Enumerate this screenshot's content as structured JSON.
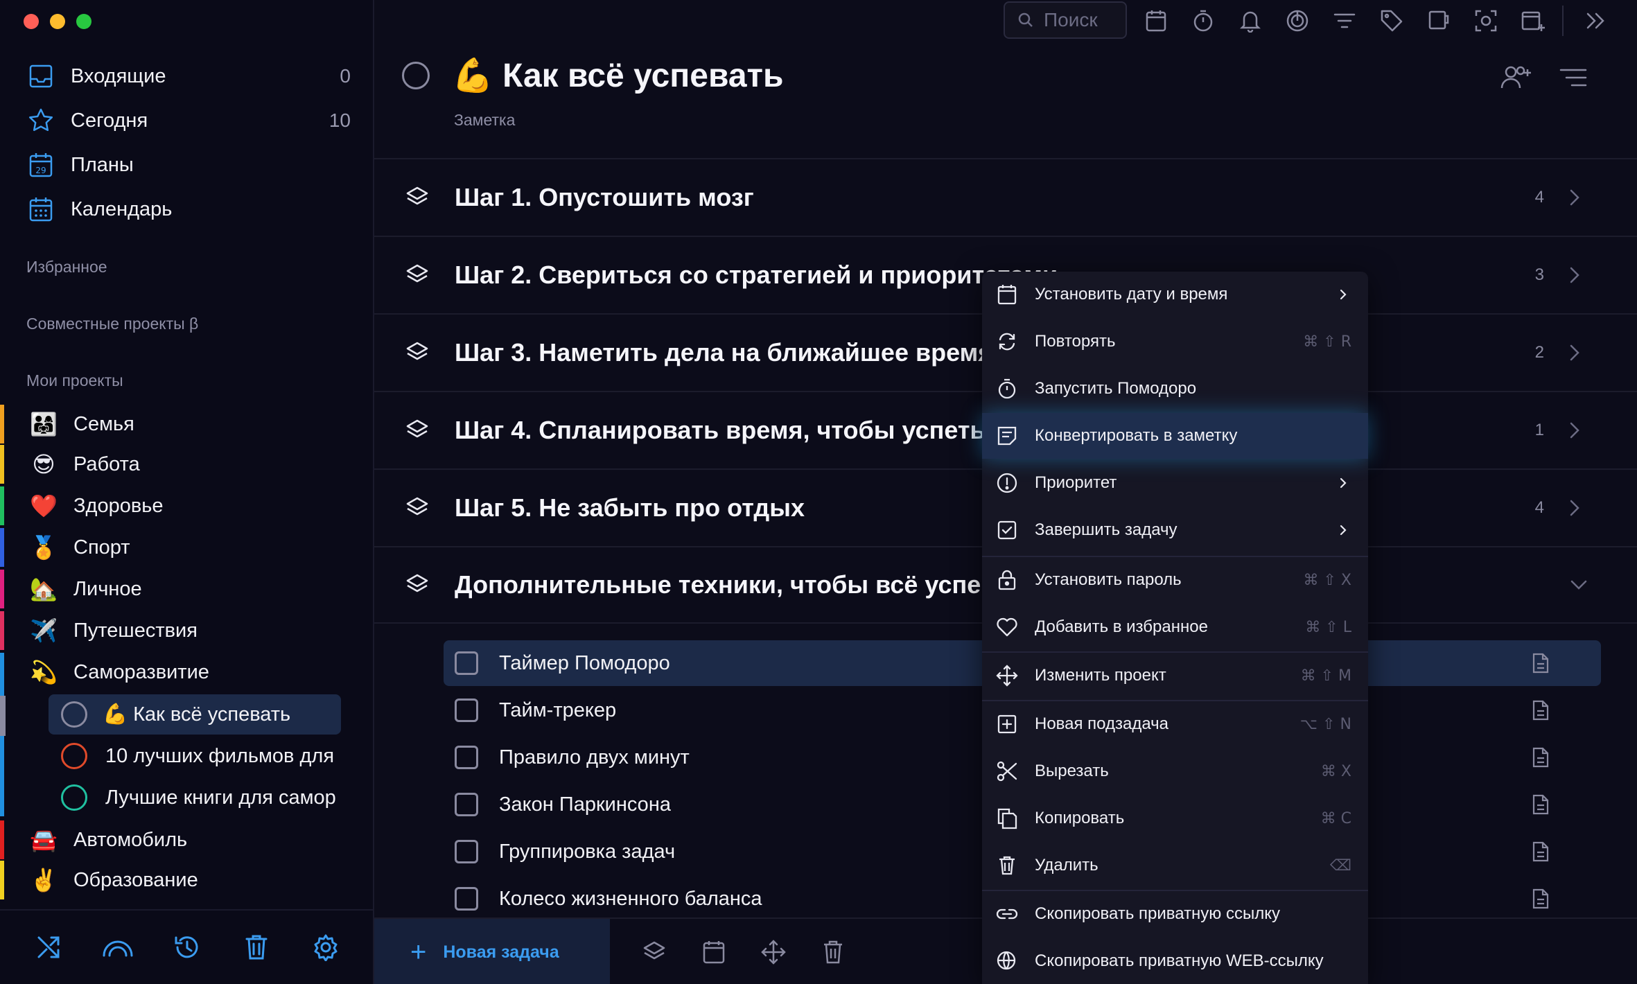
{
  "sidebar": {
    "nav": [
      {
        "label": "Входящие",
        "count": "0",
        "icon": "inbox-icon"
      },
      {
        "label": "Сегодня",
        "count": "10",
        "icon": "star-icon"
      },
      {
        "label": "Планы",
        "count": "",
        "icon": "calendar-29-icon"
      },
      {
        "label": "Календарь",
        "count": "",
        "icon": "calendar-grid-icon"
      }
    ],
    "favorites_title": "Избранное",
    "shared_title": "Совместные проекты β",
    "my_projects_title": "Мои проекты",
    "projects": [
      {
        "label": "Семья",
        "emoji": "👨‍👩‍👧",
        "color": "#f0a020"
      },
      {
        "label": "Работа",
        "emoji": "😎",
        "color": "#f0c020"
      },
      {
        "label": "Здоровье",
        "emoji": "❤️",
        "color": "#20c060"
      },
      {
        "label": "Спорт",
        "emoji": "🏅",
        "color": "#3060e0"
      },
      {
        "label": "Личное",
        "emoji": "🏡",
        "color": "#e02080"
      },
      {
        "label": "Путешествия",
        "emoji": "✈️",
        "color": "#e03060"
      },
      {
        "label": "Саморазвитие",
        "emoji": "💫",
        "color": "#2090e0"
      },
      {
        "label": "Автомобиль",
        "emoji": "🚘",
        "color": "#e02020"
      },
      {
        "label": "Образование",
        "emoji": "✌️",
        "color": "#f0d020"
      }
    ],
    "sub_items": [
      {
        "label": "💪 Как всё успевать",
        "circle": "#8a8aa0"
      },
      {
        "label": "10 лучших фильмов для",
        "circle": "#e04a2a"
      },
      {
        "label": "Лучшие книги для самор",
        "circle": "#20c0a0"
      }
    ]
  },
  "topbar": {
    "search_placeholder": "Поиск"
  },
  "header": {
    "title": "💪 Как всё успевать",
    "subtitle": "Заметка"
  },
  "sections": [
    {
      "label": "Шаг 1. Опустошить мозг",
      "count": "4"
    },
    {
      "label": "Шаг 2. Свериться со стратегией и приоритетами",
      "count": "3"
    },
    {
      "label": "Шаг 3. Наметить дела на ближайшее время",
      "count": "2"
    },
    {
      "label": "Шаг 4. Спланировать время, чтобы успеть п",
      "count": "1"
    },
    {
      "label": "Шаг 5. Не забыть про отдых",
      "count": "4"
    },
    {
      "label": "Дополнительные техники, чтобы всё успев",
      "count": ""
    }
  ],
  "tasks": [
    {
      "label": "Таймер Помодоро"
    },
    {
      "label": "Тайм-трекер"
    },
    {
      "label": "Правило двух минут"
    },
    {
      "label": "Закон Паркинсона"
    },
    {
      "label": "Группировка задач"
    },
    {
      "label": "Колесо жизненного баланса"
    }
  ],
  "bottom": {
    "new_task": "Новая задача"
  },
  "context_menu": [
    {
      "label": "Установить дату и время",
      "shortcut": "",
      "submenu": true
    },
    {
      "label": "Повторять",
      "shortcut": "⌘ ⇧ R",
      "submenu": false
    },
    {
      "label": "Запустить Помодоро",
      "shortcut": "",
      "submenu": false
    },
    {
      "label": "Конвертировать в заметку",
      "shortcut": "",
      "submenu": false
    },
    {
      "label": "Приоритет",
      "shortcut": "",
      "submenu": true
    },
    {
      "label": "Завершить задачу",
      "shortcut": "",
      "submenu": true
    },
    {
      "label": "Установить пароль",
      "shortcut": "⌘ ⇧ X",
      "submenu": false
    },
    {
      "label": "Добавить в избранное",
      "shortcut": "⌘ ⇧ L",
      "submenu": false
    },
    {
      "label": "Изменить проект",
      "shortcut": "⌘ ⇧ M",
      "submenu": false
    },
    {
      "label": "Новая подзадача",
      "shortcut": "⌥ ⇧ N",
      "submenu": false
    },
    {
      "label": "Вырезать",
      "shortcut": "⌘ X",
      "submenu": false
    },
    {
      "label": "Копировать",
      "shortcut": "⌘ C",
      "submenu": false
    },
    {
      "label": "Удалить",
      "shortcut": "⌫",
      "submenu": false
    },
    {
      "label": "Скопировать приватную ссылку",
      "shortcut": "",
      "submenu": false
    },
    {
      "label": "Скопировать приватную WEB-ссылку",
      "shortcut": "",
      "submenu": false
    }
  ],
  "colors": {
    "accent": "#3b9cf0",
    "background": "#0c0c1a",
    "selection": "#1c2a48"
  }
}
